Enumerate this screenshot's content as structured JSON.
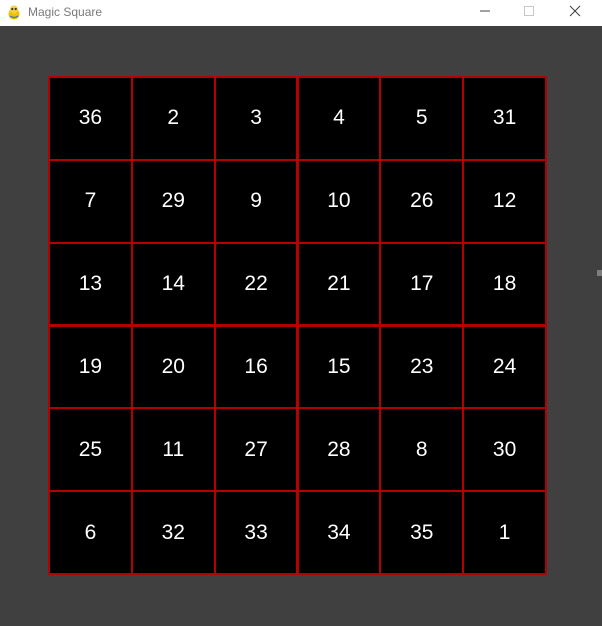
{
  "window": {
    "title": "Magic Square",
    "icon": "pygame-snake-icon",
    "controls": [
      "minimize-icon",
      "maximize-icon",
      "close-icon"
    ]
  },
  "colors": {
    "background": "#404040",
    "cell": "#000000",
    "grid_lines": "#b30000",
    "numbers": "#ffffff"
  },
  "board": {
    "size": 6,
    "cells": [
      [
        36,
        2,
        3,
        4,
        5,
        31
      ],
      [
        7,
        29,
        9,
        10,
        26,
        12
      ],
      [
        13,
        14,
        22,
        21,
        17,
        18
      ],
      [
        19,
        20,
        16,
        15,
        23,
        24
      ],
      [
        25,
        11,
        27,
        28,
        8,
        30
      ],
      [
        6,
        32,
        33,
        34,
        35,
        1
      ]
    ]
  }
}
